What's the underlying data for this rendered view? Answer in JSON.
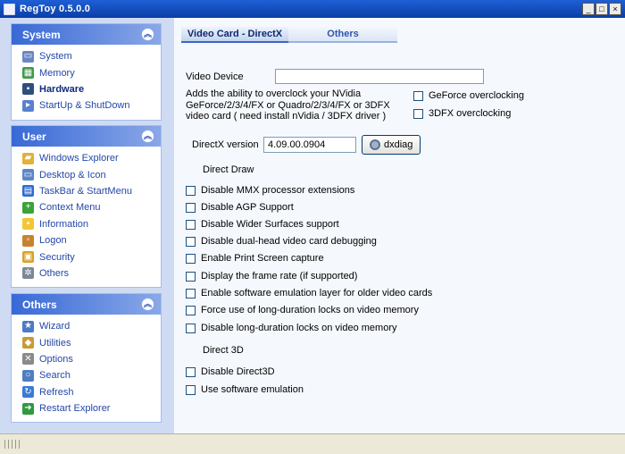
{
  "window": {
    "title": "RegToy 0.5.0.0",
    "buttons": [
      "_",
      "□",
      "×"
    ]
  },
  "sidebar": {
    "system": {
      "title": "System",
      "items": [
        {
          "label": "System",
          "icon": "monitor-icon",
          "color": "#6b86c5"
        },
        {
          "label": "Memory",
          "icon": "memory-chip-icon",
          "color": "#3f9a4a"
        },
        {
          "label": "Hardware",
          "icon": "hardware-board-icon",
          "color": "#2d4f7c",
          "active": true
        },
        {
          "label": "StartUp & ShutDown",
          "icon": "startup-icon",
          "color": "#5b7fd0"
        }
      ]
    },
    "user": {
      "title": "User",
      "items": [
        {
          "label": "Windows Explorer",
          "icon": "explorer-folder-icon",
          "color": "#e0b23c"
        },
        {
          "label": "Desktop & Icon",
          "icon": "desktop-icon",
          "color": "#5d86c9"
        },
        {
          "label": "TaskBar & StartMenu",
          "icon": "taskbar-icon",
          "color": "#2f6bd0"
        },
        {
          "label": "Context Menu",
          "icon": "plus-icon",
          "color": "#3aa33a"
        },
        {
          "label": "Information",
          "icon": "lightbulb-icon",
          "color": "#f2c733"
        },
        {
          "label": "Logon",
          "icon": "logon-icon",
          "color": "#c7832e"
        },
        {
          "label": "Security",
          "icon": "lock-icon",
          "color": "#d9a22b"
        },
        {
          "label": "Others",
          "icon": "gear-icon",
          "color": "#7d8897"
        }
      ]
    },
    "others": {
      "title": "Others",
      "items": [
        {
          "label": "Wizard",
          "icon": "wizard-icon",
          "color": "#4d79c8"
        },
        {
          "label": "Utilities",
          "icon": "utilities-icon",
          "color": "#c99a35"
        },
        {
          "label": "Options",
          "icon": "options-tools-icon",
          "color": "#8a8a8a"
        },
        {
          "label": "Search",
          "icon": "search-icon",
          "color": "#4f7dc2"
        },
        {
          "label": "Refresh",
          "icon": "refresh-icon",
          "color": "#3a7bd5"
        },
        {
          "label": "Restart Explorer",
          "icon": "restart-arrow-icon",
          "color": "#2f9a3f"
        }
      ]
    }
  },
  "tabs": {
    "active": "Video Card - DirectX",
    "other": "Others"
  },
  "video_device": {
    "label": "Video Device",
    "value": "",
    "description": "Adds the ability to overclock your NVidia GeForce/2/3/4/FX or Quadro/2/3/4/FX or 3DFX video card ( need install nVidia / 3DFX driver )",
    "geforce_label": "GeForce overclocking",
    "tdfx_label": "3DFX overclocking"
  },
  "directx": {
    "label": "DirectX version",
    "value": "4.09.00.0904",
    "button": "dxdiag"
  },
  "direct_draw": {
    "heading": "Direct Draw",
    "options": [
      "Disable MMX processor extensions",
      "Disable AGP Support",
      "Disable Wider Surfaces support",
      "Disable dual-head video card debugging",
      "Enable Print Screen capture",
      "Display the frame rate (if supported)",
      "Enable software emulation layer for older video cards",
      "Force use of long-duration locks on video memory",
      "Disable long-duration locks on video memory"
    ]
  },
  "direct_3d": {
    "heading": "Direct 3D",
    "options": [
      "Disable Direct3D",
      "Use software emulation"
    ]
  }
}
